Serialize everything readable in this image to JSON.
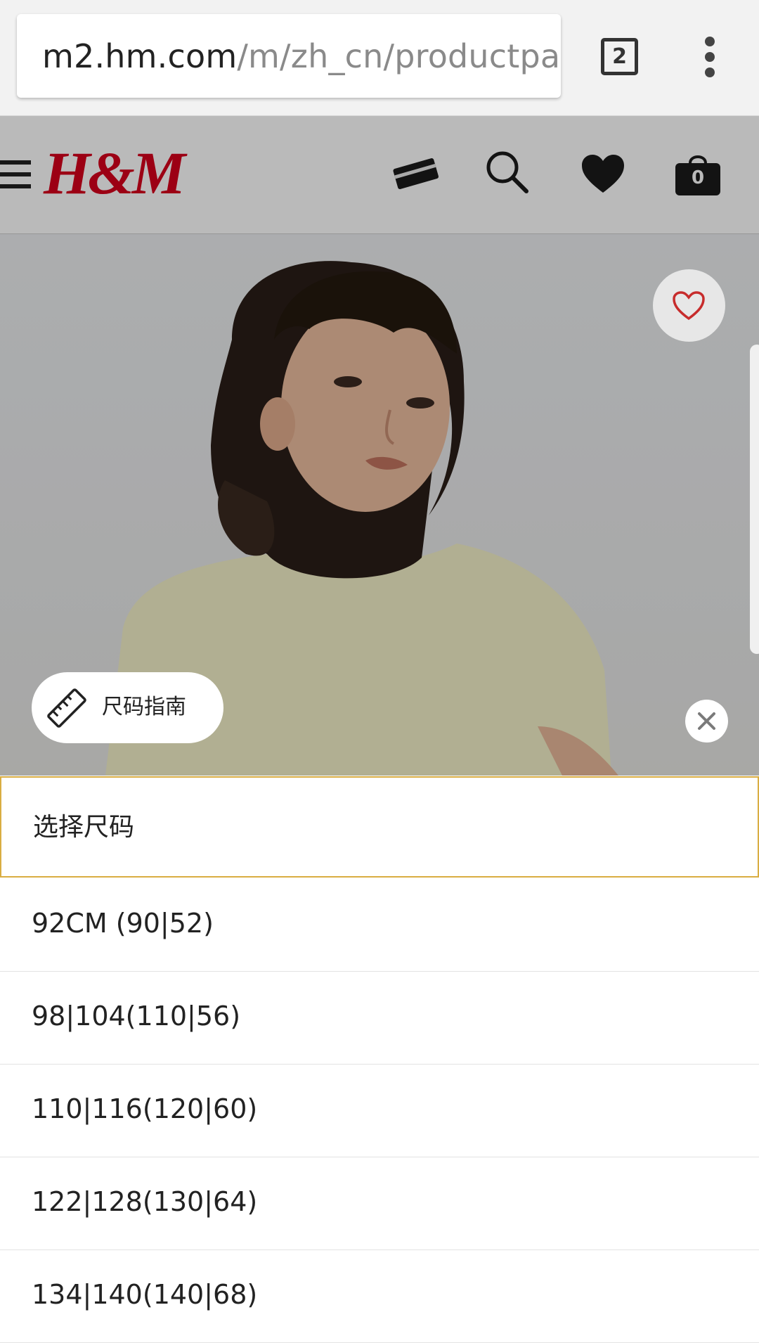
{
  "browser": {
    "url_host": "m2.hm.com",
    "url_path": "/m/zh_cn/productpag",
    "tab_count": "2",
    "icons": {
      "menu": "more-vert-icon"
    }
  },
  "header": {
    "logo": "H&M",
    "cart_count": "0",
    "icons": {
      "menu": "hamburger-icon",
      "card": "credit-card-icon",
      "search": "search-icon",
      "favourites": "heart-icon",
      "cart": "shopping-bag-icon"
    }
  },
  "product": {
    "image": "product-photo",
    "size_guide_label": "尺码指南",
    "icons": {
      "favourite": "heart-outline-icon",
      "size_guide": "ruler-icon",
      "close": "close-icon"
    }
  },
  "size_selector": {
    "label": "选择尺码",
    "options": [
      "92CM (90|52)",
      "98|104(110|56)",
      "110|116(120|60)",
      "122|128(130|64)",
      "134|140(140|68)"
    ]
  },
  "colors": {
    "brand_red": "#d6001c",
    "select_border": "#d9ad42"
  }
}
